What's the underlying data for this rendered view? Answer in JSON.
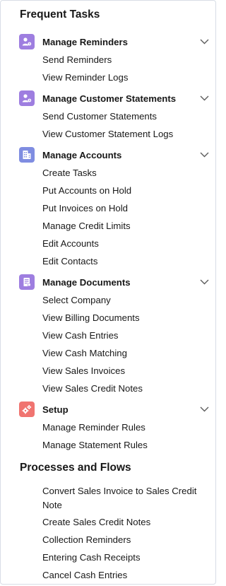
{
  "frequent_tasks": {
    "title": "Frequent Tasks",
    "groups": [
      {
        "label": "Manage Reminders",
        "icon": "user-person-icon",
        "icon_color": "#9e7ee0",
        "items": [
          "Send Reminders",
          "View Reminder Logs"
        ]
      },
      {
        "label": "Manage Customer Statements",
        "icon": "user-person-icon",
        "icon_color": "#9e7ee0",
        "items": [
          "Send Customer Statements",
          "View Customer Statement Logs"
        ]
      },
      {
        "label": "Manage Accounts",
        "icon": "building-icon",
        "icon_color": "#7f8de1",
        "items": [
          "Create Tasks",
          "Put Accounts on Hold",
          "Put Invoices on Hold",
          "Manage Credit Limits",
          "Edit Accounts",
          "Edit Contacts"
        ]
      },
      {
        "label": "Manage Documents",
        "icon": "document-icon",
        "icon_color": "#9e7ee0",
        "items": [
          "Select Company",
          "View Billing Documents",
          "View Cash Entries",
          "View Cash Matching",
          "View Sales Invoices",
          "View Sales Credit Notes"
        ]
      },
      {
        "label": "Setup",
        "icon": "gears-icon",
        "icon_color": "#f07470",
        "items": [
          "Manage Reminder Rules",
          "Manage Statement Rules"
        ]
      }
    ]
  },
  "processes_and_flows": {
    "title": "Processes and Flows",
    "items": [
      "Convert Sales Invoice to Sales Credit Note",
      "Create Sales Credit Notes",
      "Collection Reminders",
      "Entering Cash Receipts",
      "Cancel Cash Entries"
    ]
  }
}
